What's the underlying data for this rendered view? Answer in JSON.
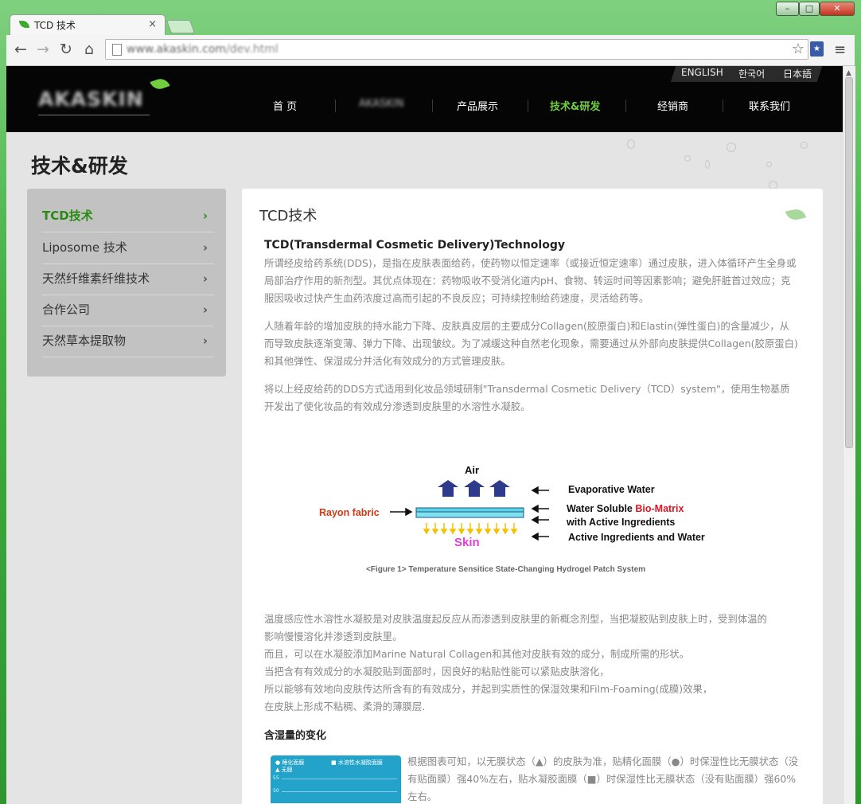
{
  "browser": {
    "tab_title": "TCD 技术",
    "tab_close": "×",
    "url_domain": "www.akaskin.com",
    "url_path": "/dev.html",
    "window_min": "–",
    "window_max": "□",
    "window_close": "✕",
    "back": "←",
    "forward": "→",
    "reload": "↻",
    "home": "⌂",
    "bookmark": "☆",
    "menu": "≡"
  },
  "site": {
    "logo": "AKASKIN",
    "languages": [
      "ENGLISH",
      "한국어",
      "日本語"
    ],
    "nav": [
      "首 页",
      "AKASKIN",
      "产品展示",
      "技术&研发",
      "经销商",
      "联系我们"
    ],
    "active_nav": "技术&研发"
  },
  "page": {
    "title": "技术&研发",
    "sidebar": [
      {
        "label": "TCD技术",
        "active": true
      },
      {
        "label": "Liposome 技术",
        "active": false
      },
      {
        "label": "天然纤维素纤维技术",
        "active": false
      },
      {
        "label": "合作公司",
        "active": false
      },
      {
        "label": "天然草本提取物",
        "active": false
      }
    ],
    "chevron": "›",
    "panel_title": "TCD技术",
    "heading": "TCD(Transdermal Cosmetic Delivery)Technology",
    "p1": "所谓经皮给药系统(DDS)，是指在皮肤表面给药，使药物以恒定速率（或接近恒定速率）通过皮肤，进入体循环产生全身或局部治疗作用的新剂型。其优点体现在：药物吸收不受消化道内pH、食物、转运时间等因素影响；避免肝脏首过效应；克服因吸收过快产生血药浓度过高而引起的不良反应；可持续控制给药速度，灵活给药等。",
    "p2": "人随着年龄的增加皮肤的持水能力下降、皮肤真皮层的主要成分Collagen(胶原蛋白)和Elastin(弹性蛋白)的含量减少，从而导致皮肤逐渐变薄、弹力下降、出现皱纹。为了减缓这种自然老化现象，需要通过从外部向皮肤提供Collagen(胶原蛋白)和其他弹性、保湿成分并活化有效成分的方式管理皮肤。",
    "p3": "将以上经皮给药的DDS方式适用到化妆品领域研制\"Transdermal Cosmetic Delivery（TCD）system\"，使用生物基质开发出了使化妆品的有效成分渗透到皮肤里的水溶性水凝胶。",
    "figure": {
      "air": "Air",
      "rayon": "Rayon fabric",
      "skin": "Skin",
      "evaporative": "Evaporative Water",
      "ws_prefix": "Water Soluble ",
      "ws_highlight": "Bio-Matrix",
      "ws_line2": "with  Active Ingredients",
      "active": "Active Ingredients and Water",
      "caption": "<Figure 1> Temperature Sensitice State-Changing Hydrogel Patch System"
    },
    "lines": [
      "温度感应性水溶性水凝胶是对皮肤温度起反应从而渗透到皮肤里的新概念剂型，当把凝胶贴到皮肤上时，受到体温的",
      "影响慢慢溶化并渗透到皮肤里。",
      "而且，可以在水凝胶添加Marine Natural Collagen和其他对皮肤有效的成分，制成所需的形状。",
      "当把含有有效成分的水凝胶贴到面部时，因良好的粘贴性能可以紧贴皮肤溶化，",
      "所以能够有效地向皮肤传达所含有的有效成分，并起到实质性的保湿效果和Film-Foaming(成膜)效果，",
      "在皮肤上形成不粘稠、柔滑的薄膜层."
    ],
    "heading2": "含湿量的变化",
    "thumb_legend": [
      "睡化面膜",
      "水溶性水凝胶面膜",
      "无膜"
    ],
    "thumb_ticks": [
      "55",
      "50"
    ],
    "p4": "根据图表可知，以无膜状态（▲）的皮肤为准，贴精化面膜（●）时保湿性比无膜状态（没有贴面膜）强40%左右，贴水凝胶面膜（■）时保湿性比无膜状态（没有贴面膜）强60%左右。"
  }
}
